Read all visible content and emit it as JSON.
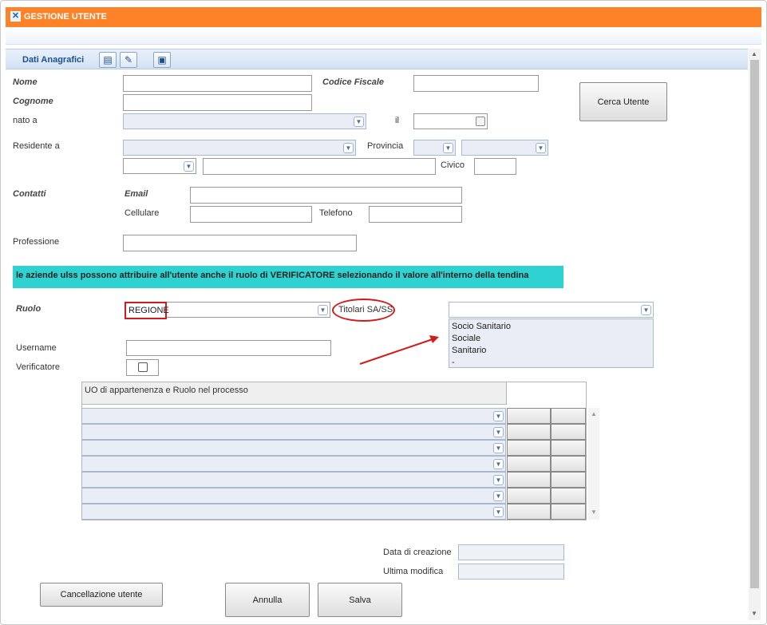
{
  "window": {
    "title": "GESTIONE UTENTE",
    "close_icon": "close-icon"
  },
  "section": {
    "title": "Dati Anagrafici",
    "icons": [
      "list-icon",
      "user-edit-icon",
      "save-disk-icon"
    ]
  },
  "form": {
    "nome_label": "Nome",
    "codice_fiscale_label": "Codice Fiscale",
    "cognome_label": "Cognome",
    "nato_a_label": "nato a",
    "il_label": "il",
    "residente_label": "Residente a",
    "provincia_label": "Provincia",
    "civico_label": "Civico",
    "contatti_label": "Contatti",
    "email_label": "Email",
    "cellulare_label": "Cellulare",
    "telefono_label": "Telefono",
    "professione_label": "Professione",
    "ruolo_label": "Ruolo",
    "ruolo_value": "REGIONE",
    "titolari_label": "Titolari SA/SS",
    "username_label": "Username",
    "verificatore_label": "Verificatore",
    "data_creazione_label": "Data di creazione",
    "ultima_modifica_label": "Ultima modifica"
  },
  "buttons": {
    "cerca": "Cerca Utente",
    "cancellazione": "Cancellazione utente",
    "annulla": "Annulla",
    "salva": "Salva"
  },
  "banner": "le aziende ulss possono attribuire all'utente anche il ruolo di VERIFICATORE selezionando il valore all'interno della tendina",
  "titolari_options": [
    "Socio Sanitario",
    "Sociale",
    "Sanitario",
    "-"
  ],
  "grid": {
    "header": "UO di appartenenza e Ruolo nel processo",
    "rows": 7
  },
  "colors": {
    "titlebar": "#fe8227",
    "banner": "#2ed3d1",
    "annotation": "#d21b1b"
  }
}
